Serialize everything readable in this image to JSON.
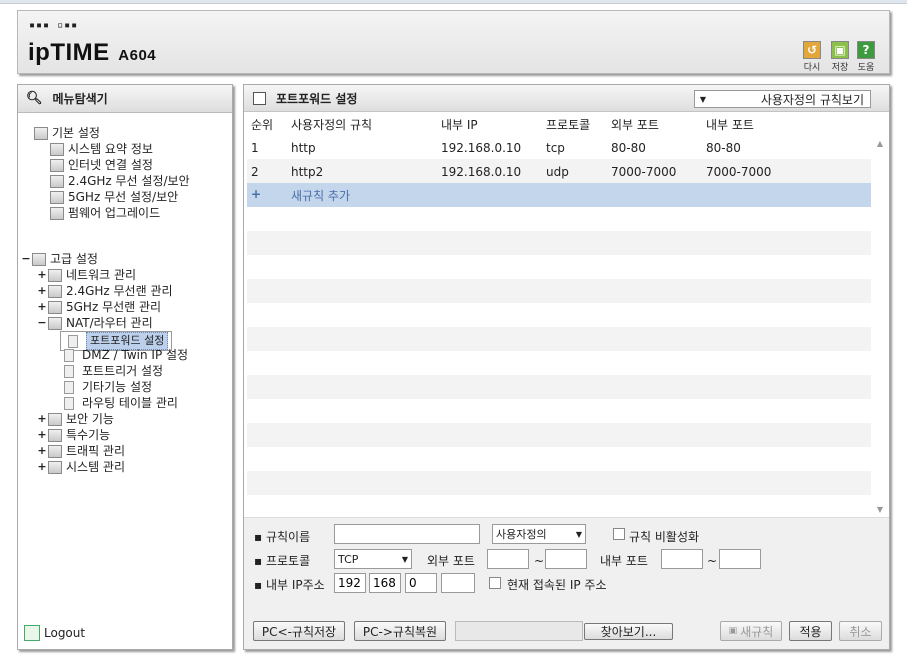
{
  "header": {
    "logo_dots": "▪▪▪ ▫▪▪",
    "brand": "ipTIME",
    "model": "A604",
    "buttons": [
      {
        "label": "다시",
        "icon": "undo-icon",
        "color": "#e3a63a"
      },
      {
        "label": "저장",
        "icon": "save-icon",
        "color": "#8cc04a"
      },
      {
        "label": "도움",
        "icon": "help-icon",
        "color": "#3e9a3e"
      }
    ]
  },
  "sidebar": {
    "title": "메뉴탐색기",
    "logout": "Logout",
    "basic": {
      "label": "기본 설정",
      "items": [
        "시스템 요약 정보",
        "인터넷 연결 설정",
        "2.4GHz 무선 설정/보안",
        "5GHz 무선 설정/보안",
        "펌웨어 업그레이드"
      ]
    },
    "advanced": {
      "label": "고급 설정",
      "expander": "−",
      "groups": [
        {
          "label": "네트워크 관리",
          "expander": "+"
        },
        {
          "label": "2.4GHz 무선랜 관리",
          "expander": "+"
        },
        {
          "label": "5GHz 무선랜 관리",
          "expander": "+"
        },
        {
          "label": "NAT/라우터 관리",
          "expander": "−"
        }
      ],
      "nat_items": [
        "포트포워드 설정",
        "DMZ / Twin IP 설정",
        "포트트리거 설정",
        "기타기능 설정",
        "라우팅 테이블 관리"
      ],
      "other_groups": [
        {
          "label": "보안 기능",
          "expander": "+"
        },
        {
          "label": "특수기능",
          "expander": "+"
        },
        {
          "label": "트래픽 관리",
          "expander": "+"
        },
        {
          "label": "시스템 관리",
          "expander": "+"
        }
      ]
    }
  },
  "main": {
    "title": "포트포워드 설정",
    "view_select": "사용자정의 규칙보기",
    "columns": [
      "순위",
      "사용자정의 규칙",
      "내부 IP",
      "프로토콜",
      "외부 포트",
      "내부 포트"
    ],
    "rows": [
      {
        "rank": "1",
        "name": "http",
        "ip": "192.168.0.10",
        "proto": "tcp",
        "ext": "80-80",
        "int": "80-80"
      },
      {
        "rank": "2",
        "name": "http2",
        "ip": "192.168.0.10",
        "proto": "udp",
        "ext": "7000-7000",
        "int": "7000-7000"
      }
    ],
    "add_rule": {
      "icon": "+",
      "label": "새규칙 추가"
    }
  },
  "form": {
    "rule_name_label": "▪ 규칙이름",
    "rule_name_value": "",
    "rule_type": "사용자정의",
    "disable_label": "규칙 비활성화",
    "protocol_label": "▪ 프로토콜",
    "protocol_value": "TCP",
    "ext_port_label": "외부 포트",
    "int_port_label": "내부 포트",
    "tilde": "~",
    "ip_label": "▪ 내부 IP주소",
    "ip": [
      "192",
      "168",
      "0",
      ""
    ],
    "current_ip_label": "현재 접속된 IP 주소",
    "buttons": {
      "save_pc": "PC<-규칙저장",
      "restore_pc": "PC->규칙복원",
      "browse": "찾아보기...",
      "new_rule": "새규칙",
      "apply": "적용",
      "cancel": "취소"
    }
  }
}
